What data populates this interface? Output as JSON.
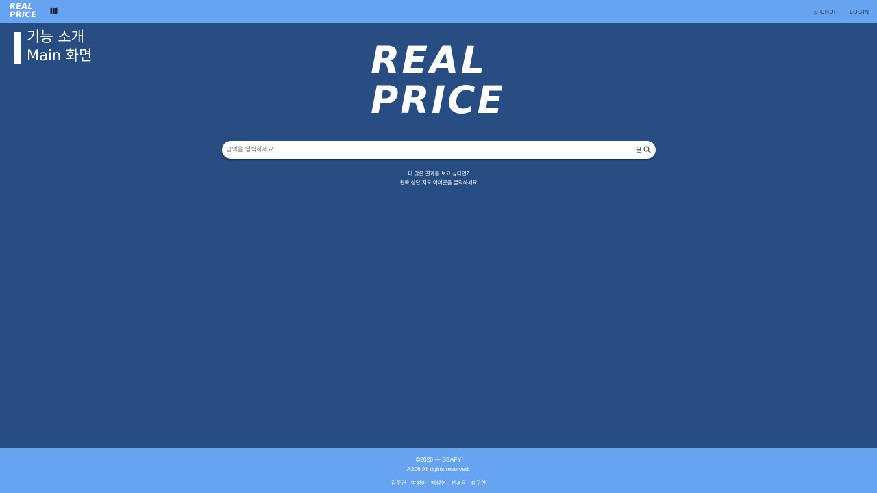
{
  "header": {
    "logo_line1": "REAL",
    "logo_line2": "PRICE",
    "map_icon": "map-icon",
    "signup_label": "SIGNUP",
    "login_label": "LOGIN"
  },
  "overlay": {
    "title_line1": "기능 소개",
    "title_line2": "Main 화면"
  },
  "hero": {
    "logo_line1": "REAL",
    "logo_line2": "PRICE"
  },
  "search": {
    "placeholder": "금액을 입력하세요",
    "value": "",
    "unit": "원",
    "icon": "search-icon"
  },
  "hint": {
    "line1": "더 많은 결과를 보고 싶다면?",
    "line2": "왼쪽 상단 지도 아이콘을 클릭하세요"
  },
  "footer": {
    "copyright": "©2020 — SSAFY",
    "rights": "A206 All rights reserved.",
    "members": [
      "김주연",
      "박정환",
      "백창현",
      "전경윤",
      "정구현"
    ]
  },
  "colors": {
    "background": "#284d82",
    "bar": "#66a3f0",
    "text": "#ffffff"
  }
}
